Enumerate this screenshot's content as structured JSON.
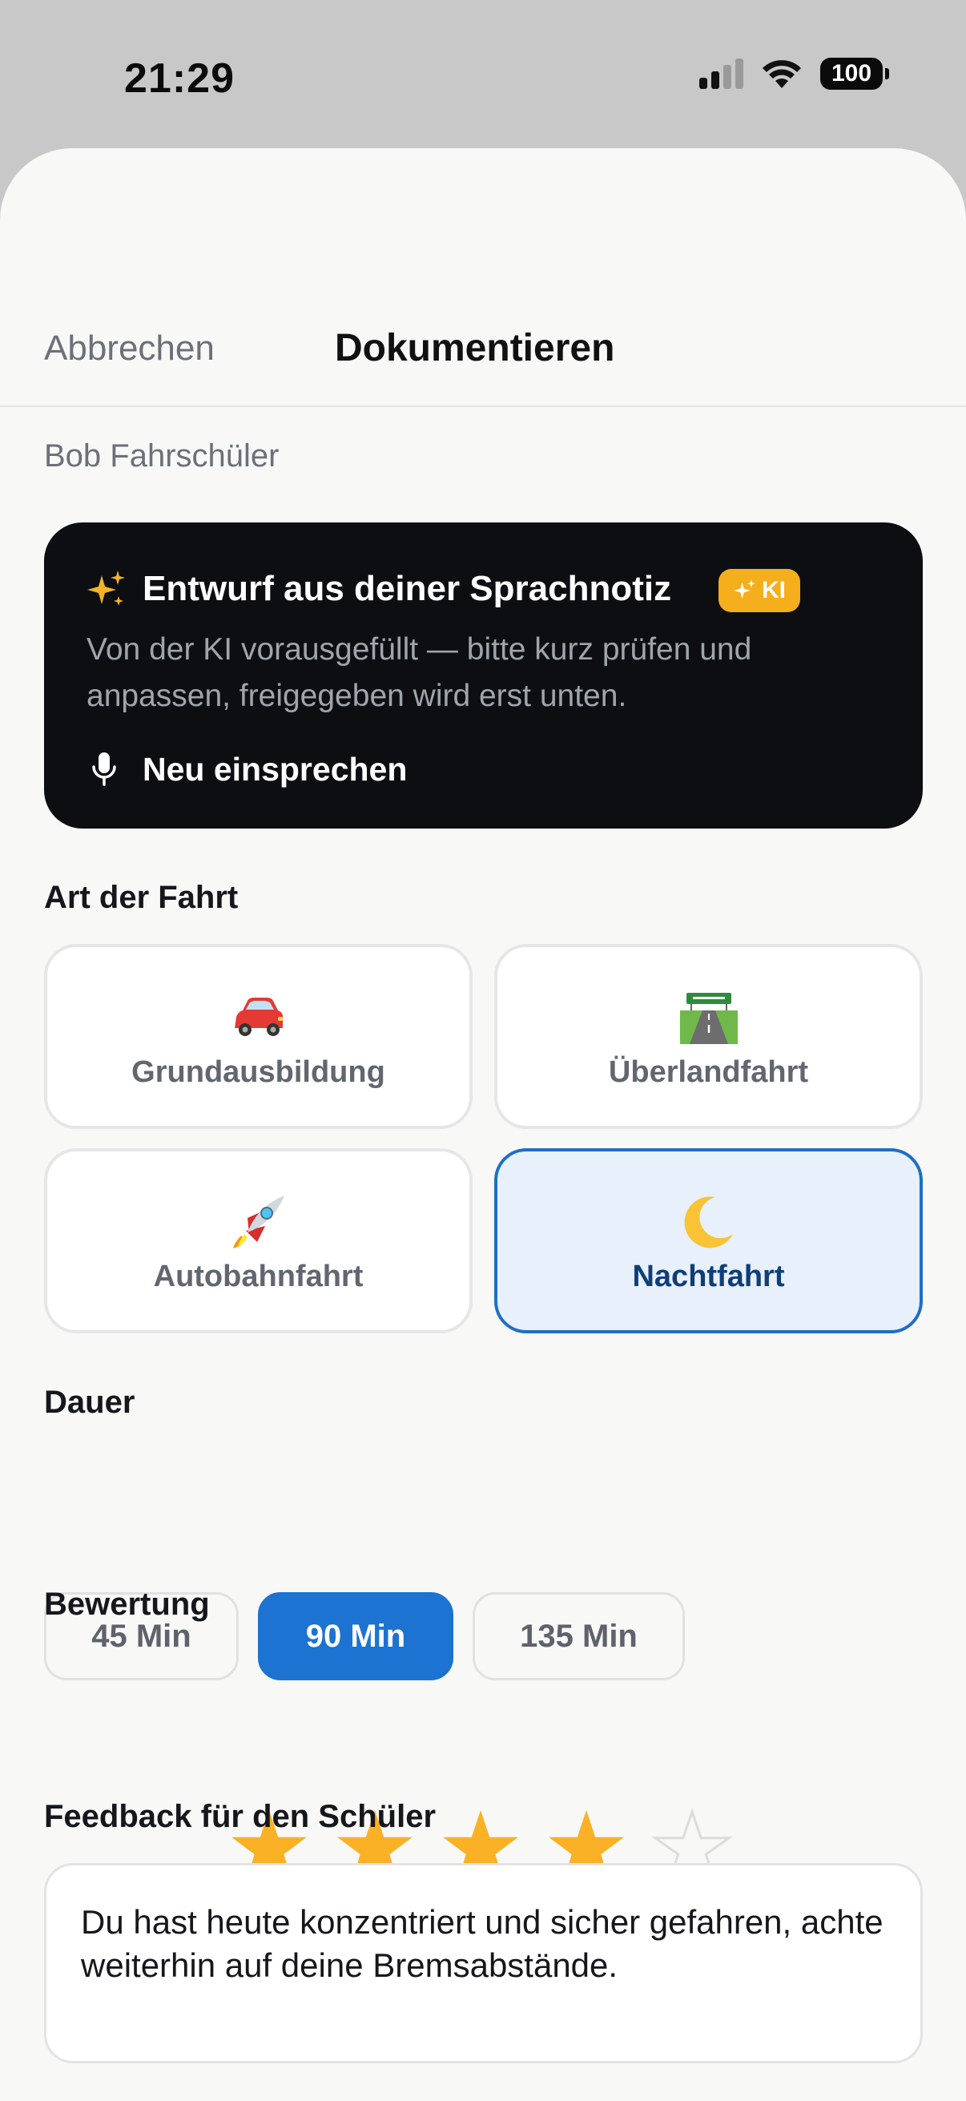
{
  "status_bar": {
    "time": "21:29",
    "battery": "100",
    "icons": [
      "cellular-signal-icon",
      "wifi-icon",
      "battery-icon"
    ]
  },
  "nav": {
    "cancel": "Abbrechen",
    "title": "Dokumentieren"
  },
  "student_name": "Bob Fahrschüler",
  "ai_card": {
    "heading": "Entwurf aus deiner Sprachnotiz",
    "badge": "KI",
    "description": "Von der KI vorausgefüllt — bitte kurz prüfen und anpassen, freigegeben wird erst unten.",
    "record_again": "Neu einsprechen",
    "icons": [
      "sparkles-icon",
      "microphone-icon"
    ]
  },
  "ride_type": {
    "label": "Art der Fahrt",
    "options": [
      {
        "label": "Grundausbildung",
        "icon": "car-icon",
        "selected": false
      },
      {
        "label": "Überlandfahrt",
        "icon": "motorway-icon",
        "selected": false
      },
      {
        "label": "Autobahnfahrt",
        "icon": "rocket-icon",
        "selected": false
      },
      {
        "label": "Nachtfahrt",
        "icon": "crescent-moon-icon",
        "selected": true
      }
    ]
  },
  "duration": {
    "label": "Dauer",
    "options": [
      "45 Min",
      "90 Min",
      "135 Min"
    ],
    "selected": "90 Min"
  },
  "rating": {
    "label": "Bewertung",
    "value": 4,
    "max": 5
  },
  "feedback": {
    "label": "Feedback für den Schüler",
    "value": "Du hast heute konzentriert und sicher gefahren, achte weiterhin auf deine Bremsabstände."
  },
  "colors": {
    "accent": "#1c73d1",
    "star": "#fbb125",
    "ai_badge": "#f5ae1c",
    "ai_card": "#0c0e12"
  }
}
